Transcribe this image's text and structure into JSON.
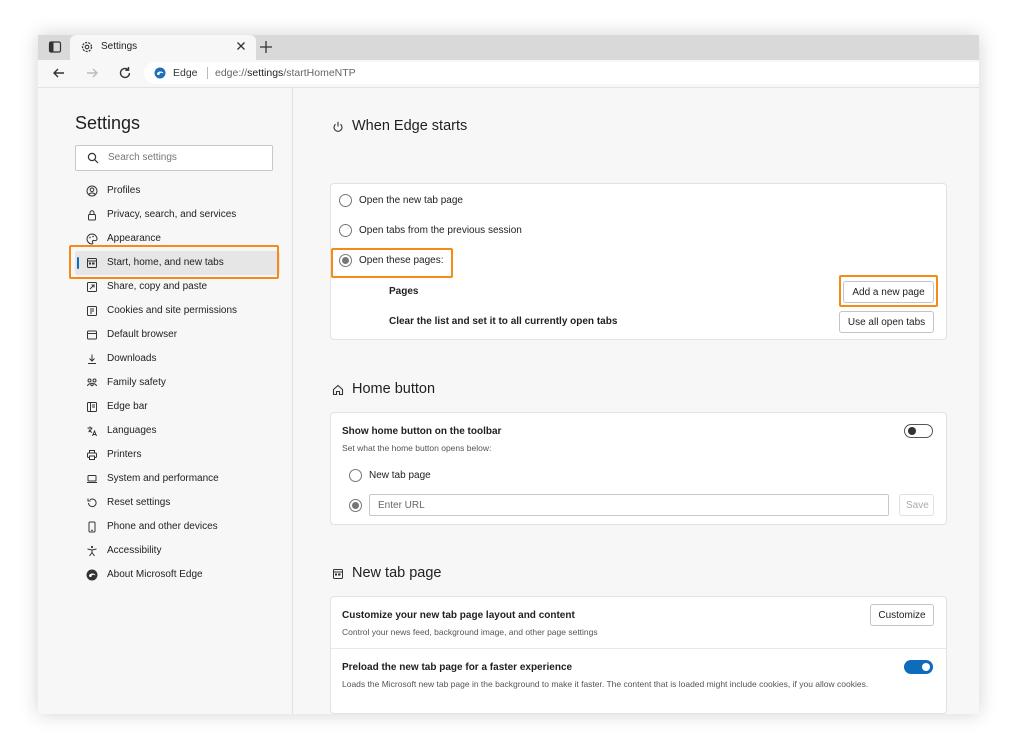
{
  "tab": {
    "title": "Settings",
    "new_tab_glyph": "+"
  },
  "address": {
    "site_label": "Edge",
    "url_host": "edge://",
    "url_bold": "settings",
    "url_path": "/startHomeNTP"
  },
  "icons": {
    "tab_actions": "tab-actions-icon",
    "tab_gear": "gear-icon",
    "tab_close": "close-icon",
    "back": "back-arrow-icon",
    "forward": "forward-arrow-icon",
    "refresh": "refresh-icon",
    "edge": "edge-logo-icon"
  },
  "sidebar": {
    "title": "Settings",
    "search_placeholder": "Search settings",
    "items": [
      {
        "label": "Profiles",
        "icon": "profile-icon"
      },
      {
        "label": "Privacy, search, and services",
        "icon": "lock-icon"
      },
      {
        "label": "Appearance",
        "icon": "appearance-icon"
      },
      {
        "label": "Start, home, and new tabs",
        "icon": "start-page-icon",
        "active": true
      },
      {
        "label": "Share, copy and paste",
        "icon": "share-icon"
      },
      {
        "label": "Cookies and site permissions",
        "icon": "cookies-icon"
      },
      {
        "label": "Default browser",
        "icon": "default-browser-icon"
      },
      {
        "label": "Downloads",
        "icon": "download-icon"
      },
      {
        "label": "Family safety",
        "icon": "family-icon"
      },
      {
        "label": "Edge bar",
        "icon": "edge-bar-icon"
      },
      {
        "label": "Languages",
        "icon": "languages-icon"
      },
      {
        "label": "Printers",
        "icon": "printer-icon"
      },
      {
        "label": "System and performance",
        "icon": "system-icon"
      },
      {
        "label": "Reset settings",
        "icon": "reset-icon"
      },
      {
        "label": "Phone and other devices",
        "icon": "phone-icon"
      },
      {
        "label": "Accessibility",
        "icon": "accessibility-icon"
      },
      {
        "label": "About Microsoft Edge",
        "icon": "edge-logo-icon"
      }
    ]
  },
  "when_edge_starts": {
    "title": "When Edge starts",
    "options": [
      {
        "label": "Open the new tab page",
        "selected": false
      },
      {
        "label": "Open tabs from the previous session",
        "selected": false
      },
      {
        "label": "Open these pages:",
        "selected": true
      }
    ],
    "pages_label": "Pages",
    "add_page_button": "Add a new page",
    "clear_label": "Clear the list and set it to all currently open tabs",
    "use_open_tabs_button": "Use all open tabs"
  },
  "home_button": {
    "title": "Home button",
    "show_label": "Show home button on the toolbar",
    "show_sub": "Set what the home button opens below:",
    "toggle_on": false,
    "option_new_tab": "New tab page",
    "url_placeholder": "Enter URL",
    "save_button": "Save"
  },
  "new_tab_page": {
    "title": "New tab page",
    "customize_label": "Customize your new tab page layout and content",
    "customize_sub": "Control your news feed, background image, and other page settings",
    "customize_button": "Customize",
    "preload_label": "Preload the new tab page for a faster experience",
    "preload_sub": "Loads the Microsoft new tab page in the background to make it faster. The content that is loaded might include cookies, if you allow cookies.",
    "preload_on": true
  },
  "colors": {
    "highlight": "#f28c16",
    "accent": "#0f6cbd"
  }
}
